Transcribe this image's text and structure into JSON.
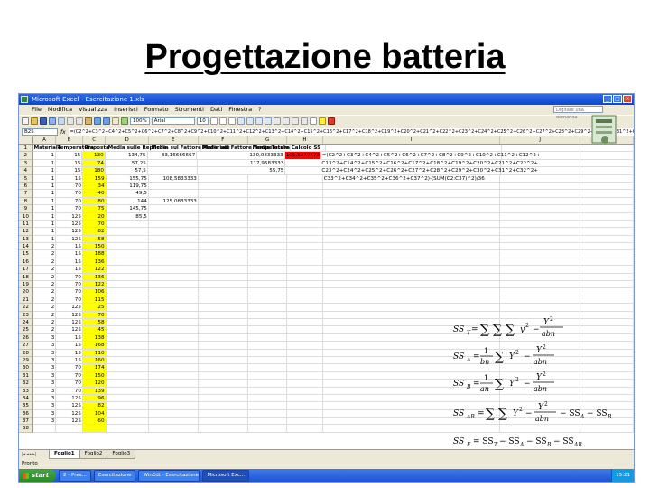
{
  "slide_title": "Progettazione batteria",
  "window": {
    "title": "Microsoft Excel - Esercitazione 1.xls",
    "controls": [
      "_",
      "□",
      "×"
    ]
  },
  "menu": {
    "items": [
      "File",
      "Modifica",
      "Visualizza",
      "Inserisci",
      "Formato",
      "Strumenti",
      "Dati",
      "Finestra",
      "?"
    ],
    "help_placeholder": "Digitare una domanda"
  },
  "toolbar": {
    "font": "Arial",
    "size": "10",
    "zoom": "100%"
  },
  "formula_bar": {
    "name_box": "B25",
    "fx": "fx",
    "formula": "=(C2^2+C3^2+C4^2+C5^2+C6^2+C7^2+C8^2+C9^2+C10^2+C11^2+C12^2+C13^2+C14^2+C15^2+C16^2+C17^2+C18^2+C19^2+C20^2+C21^2+C22^2+C23^2+C24^2+C25^2+C26^2+C27^2+C28^2+C29^2+C30^2+C31^2+C32^2+C33^2+C34^2+C35^2+C36^2+C37^2)-(SUM(C2:C37)^2)/36"
  },
  "sheet": {
    "col_headers": [
      "A",
      "B",
      "C",
      "D",
      "E",
      "F",
      "G",
      "H",
      "I",
      "J",
      "K"
    ],
    "header_row": [
      "Materiale",
      "Temperatura",
      "Risposta",
      "Media sulle Repliche",
      "Media sul Fattore Materiale",
      "Media sul Fattore Temperatura",
      "Media Totale",
      "Calcolo SS",
      "",
      "",
      ""
    ],
    "rows": [
      [
        "1",
        "15",
        "130",
        "134,75",
        "83,16666667",
        "",
        "130,0833333",
        "105,5277778",
        "=(C2^2+C3^2+C4^2+C5^2+C6^2+C7^2+C8^2+C9^2+C10^2+C11^2+C12^2+",
        "",
        ""
      ],
      [
        "1",
        "15",
        "74",
        "57,25",
        "",
        "",
        "117,9583333",
        "",
        "C13^2+C14^2+C15^2+C16^2+C17^2+C18^2+C19^2+C20^2+C21^2+C22^2+",
        "",
        ""
      ],
      [
        "1",
        "15",
        "180",
        "57,5",
        "",
        "",
        "55,75",
        "",
        "C23^2+C24^2+C25^2+C26^2+C27^2+C28^2+C29^2+C30^2+C31^2+C32^2+",
        "",
        ""
      ],
      [
        "1",
        "15",
        "159",
        "155,75",
        "108,5833333",
        "",
        "",
        "",
        "C33^2+C34^2+C35^2+C36^2+C37^2)-(SUM(C2:C37)^2)/36",
        "",
        ""
      ],
      [
        "1",
        "70",
        "34",
        "119,75",
        "",
        "",
        "",
        "",
        "",
        "",
        ""
      ],
      [
        "1",
        "70",
        "40",
        "49,5",
        "",
        "",
        "",
        "",
        "",
        "",
        ""
      ],
      [
        "1",
        "70",
        "80",
        "144",
        "125,0833333",
        "",
        "",
        "",
        "",
        "",
        ""
      ],
      [
        "1",
        "70",
        "75",
        "145,75",
        "",
        "",
        "",
        "",
        "",
        "",
        ""
      ],
      [
        "1",
        "125",
        "20",
        "85,5",
        "",
        "",
        "",
        "",
        "",
        "",
        ""
      ],
      [
        "1",
        "125",
        "70",
        "",
        "",
        "",
        "",
        "",
        "",
        "",
        ""
      ],
      [
        "1",
        "125",
        "82",
        "",
        "",
        "",
        "",
        "",
        "",
        "",
        ""
      ],
      [
        "1",
        "125",
        "58",
        "",
        "",
        "",
        "",
        "",
        "",
        "",
        ""
      ],
      [
        "2",
        "15",
        "150",
        "",
        "",
        "",
        "",
        "",
        "",
        "",
        ""
      ],
      [
        "2",
        "15",
        "188",
        "",
        "",
        "",
        "",
        "",
        "",
        "",
        ""
      ],
      [
        "2",
        "15",
        "136",
        "",
        "",
        "",
        "",
        "",
        "",
        "",
        ""
      ],
      [
        "2",
        "15",
        "122",
        "",
        "",
        "",
        "",
        "",
        "",
        "",
        ""
      ],
      [
        "2",
        "70",
        "136",
        "",
        "",
        "",
        "",
        "",
        "",
        "",
        ""
      ],
      [
        "2",
        "70",
        "122",
        "",
        "",
        "",
        "",
        "",
        "",
        "",
        ""
      ],
      [
        "2",
        "70",
        "106",
        "",
        "",
        "",
        "",
        "",
        "",
        "",
        ""
      ],
      [
        "2",
        "70",
        "115",
        "",
        "",
        "",
        "",
        "",
        "",
        "",
        ""
      ],
      [
        "2",
        "125",
        "25",
        "",
        "",
        "",
        "",
        "",
        "",
        "",
        ""
      ],
      [
        "2",
        "125",
        "70",
        "",
        "",
        "",
        "",
        "",
        "",
        "",
        ""
      ],
      [
        "2",
        "125",
        "58",
        "",
        "",
        "",
        "",
        "",
        "",
        "",
        ""
      ],
      [
        "2",
        "125",
        "45",
        "",
        "",
        "",
        "",
        "",
        "",
        "",
        ""
      ],
      [
        "3",
        "15",
        "138",
        "",
        "",
        "",
        "",
        "",
        "",
        "",
        ""
      ],
      [
        "3",
        "15",
        "168",
        "",
        "",
        "",
        "",
        "",
        "",
        "",
        ""
      ],
      [
        "3",
        "15",
        "110",
        "",
        "",
        "",
        "",
        "",
        "",
        "",
        ""
      ],
      [
        "3",
        "15",
        "160",
        "",
        "",
        "",
        "",
        "",
        "",
        "",
        ""
      ],
      [
        "3",
        "70",
        "174",
        "",
        "",
        "",
        "",
        "",
        "",
        "",
        ""
      ],
      [
        "3",
        "70",
        "150",
        "",
        "",
        "",
        "",
        "",
        "",
        "",
        ""
      ],
      [
        "3",
        "70",
        "120",
        "",
        "",
        "",
        "",
        "",
        "",
        "",
        ""
      ],
      [
        "3",
        "70",
        "139",
        "",
        "",
        "",
        "",
        "",
        "",
        "",
        ""
      ],
      [
        "3",
        "125",
        "96",
        "",
        "",
        "",
        "",
        "",
        "",
        "",
        ""
      ],
      [
        "3",
        "125",
        "82",
        "",
        "",
        "",
        "",
        "",
        "",
        "",
        ""
      ],
      [
        "3",
        "125",
        "104",
        "",
        "",
        "",
        "",
        "",
        "",
        "",
        ""
      ],
      [
        "3",
        "125",
        "60",
        "",
        "",
        "",
        "",
        "",
        "",
        "",
        ""
      ],
      [
        "",
        "",
        "",
        "",
        "",
        "",
        "",
        "",
        "",
        "",
        ""
      ]
    ]
  },
  "sheet_tabs": [
    "Foglio1",
    "Foglio2",
    "Foglio3"
  ],
  "status": "Pronto",
  "taskbar": {
    "start": "start",
    "items": [
      "2 - Pres...",
      "Esercitazione",
      "WinEdt - Esercitazione",
      "Microsoft Exc..."
    ],
    "clock": "15:21"
  },
  "formulas": {
    "ss_t": "SS_T = Σ Σ Σ y² − Y²/abn",
    "ss_a": "SS_A = 1/bn Σ Y² − Y²/abn",
    "ss_b": "SS_B = 1/an Σ Y² − Y²/abn",
    "ss_ab": "SS_AB = Σ Σ Y² − Y²/abn − SS_A − SS_B",
    "ss_e": "SS_E = SS_T − SS_A − SS_B − SS_AB"
  }
}
